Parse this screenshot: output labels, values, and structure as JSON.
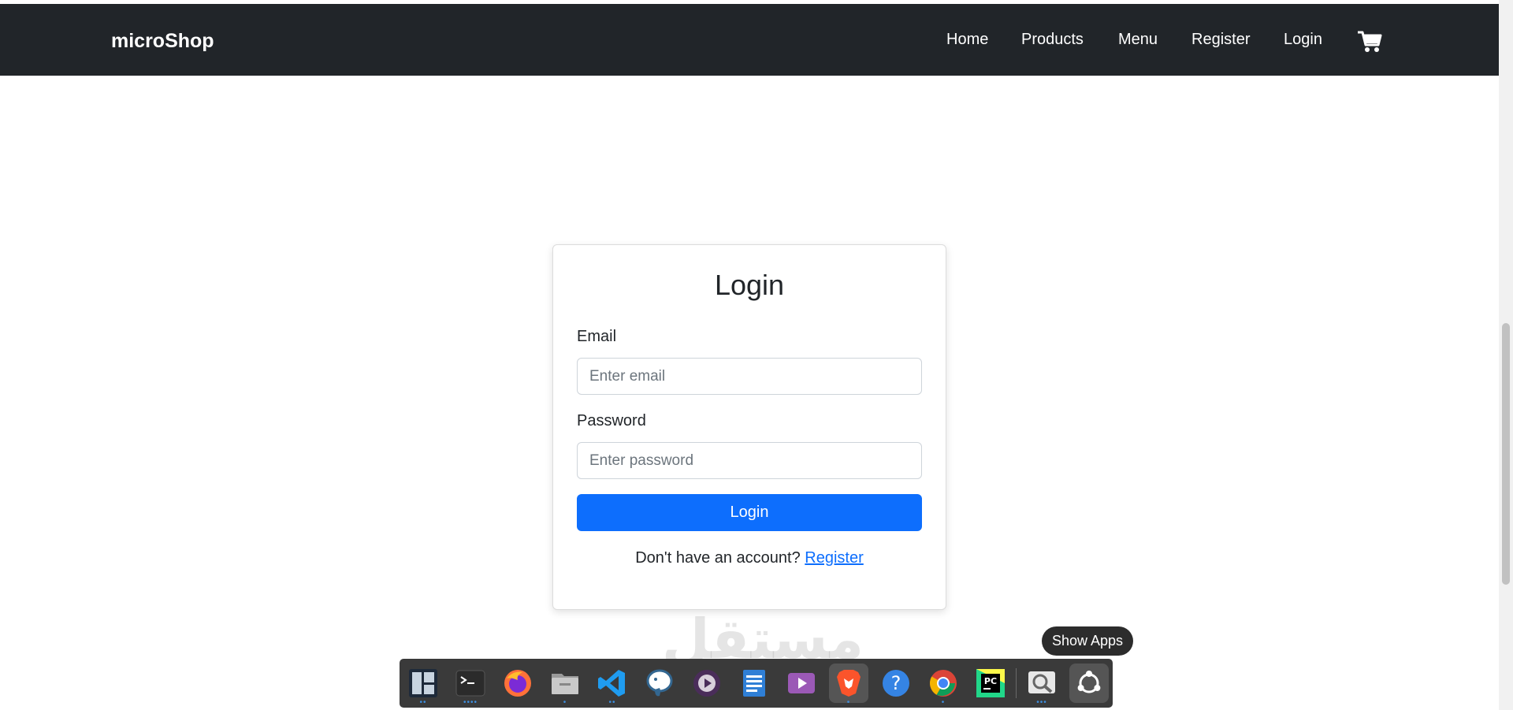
{
  "navbar": {
    "brand": "microShop",
    "links": [
      "Home",
      "Products",
      "Menu",
      "Register",
      "Login"
    ],
    "cart_icon": "cart-icon",
    "background": "#212529"
  },
  "login_form": {
    "title": "Login",
    "email_label": "Email",
    "email_placeholder": "Enter email",
    "email_value": "",
    "password_label": "Password",
    "password_placeholder": "Enter password",
    "password_value": "",
    "submit_label": "Login",
    "register_prompt": "Don't have an account?",
    "register_link": "Register",
    "accent": "#0d6efd"
  },
  "watermark": "مستقل",
  "dock": {
    "tooltip": "Show Apps",
    "items": [
      {
        "name": "window-manager-icon",
        "dots": "••"
      },
      {
        "name": "terminal-icon",
        "dots": "••••"
      },
      {
        "name": "firefox-icon",
        "dots": ""
      },
      {
        "name": "files-icon",
        "dots": "•"
      },
      {
        "name": "vscode-icon",
        "dots": "••"
      },
      {
        "name": "postgresql-icon",
        "dots": ""
      },
      {
        "name": "media-player-icon",
        "dots": ""
      },
      {
        "name": "text-editor-icon",
        "dots": ""
      },
      {
        "name": "video-icon",
        "dots": ""
      },
      {
        "name": "brave-icon",
        "dots": "•"
      },
      {
        "name": "help-icon",
        "dots": ""
      },
      {
        "name": "chrome-icon",
        "dots": "•"
      },
      {
        "name": "pycharm-icon",
        "dots": ""
      },
      {
        "name": "image-viewer-icon",
        "dots": "•••"
      },
      {
        "name": "show-apps-icon",
        "dots": ""
      }
    ]
  }
}
